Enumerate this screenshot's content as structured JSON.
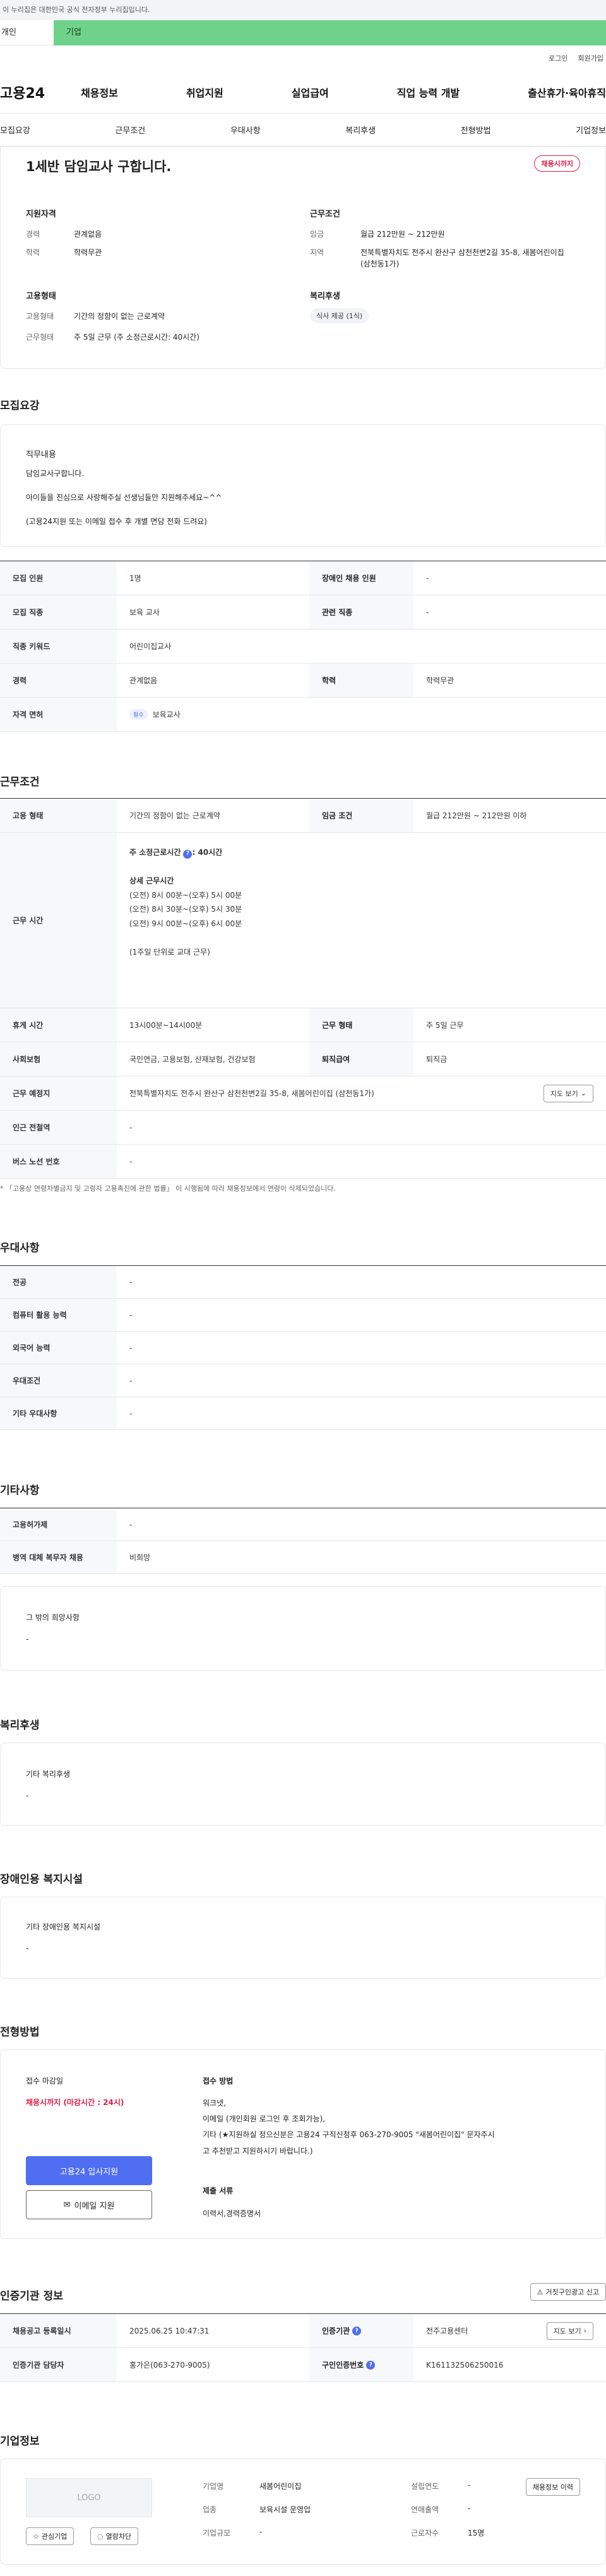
{
  "gov_banner": "이 누리집은 대한민국 공식 전자정부 누리집입니다.",
  "segment": {
    "a": "개인",
    "b": "기업"
  },
  "util": {
    "login": "로그인",
    "join": "회원가입"
  },
  "gnb": {
    "logo": "고용24",
    "items": [
      "채용정보",
      "취업지원",
      "실업급여",
      "직업 능력 개발",
      "출산휴가·육아휴직"
    ]
  },
  "tabs": [
    "모집요강",
    "근무조건",
    "우대사항",
    "복리후생",
    "전형방법",
    "기업정보"
  ],
  "summary": {
    "title": "1세반 담임교사 구합니다.",
    "status": "채용시까지",
    "qual": {
      "title": "지원자격",
      "rows": [
        {
          "k": "경력",
          "v": "관계없음"
        },
        {
          "k": "학력",
          "v": "학력무관"
        }
      ]
    },
    "cond": {
      "title": "근무조건",
      "rows": [
        {
          "k": "임금",
          "v": "월급 212만원 ~ 212만원"
        },
        {
          "k": "지역",
          "v": "전북특별자치도 전주시 완산구 삼천천변2길 35-8, 새봄어린이집 (삼천동1가)"
        }
      ]
    },
    "emp": {
      "title": "고용형태",
      "rows": [
        {
          "k": "고용형태",
          "v": "기간의 정함이 없는 근로계약"
        },
        {
          "k": "근무형태",
          "v": "주 5일 근무 (주 소정근로시간: 40시간)"
        }
      ]
    },
    "welfare": {
      "title": "복리후생",
      "tag": "식사 제공 (1식)"
    }
  },
  "recruit": {
    "heading": "모집요강",
    "duty_title": "직무내용",
    "duty_lines": [
      "담임교사구합니다.",
      "아이들을 진심으로 사랑해주실 선생님들만 지원해주세요~^^",
      "(고용24지원 또는 이메일 접수 후 개별 면담 전화 드려요)"
    ],
    "rows": [
      {
        "k1": "모집 인원",
        "v1": "1명",
        "k2": "장애인 채용 인원",
        "v2": "-"
      },
      {
        "k1": "모집 직종",
        "v1": "보육 교사",
        "k2": "관련 직종",
        "v2": "-"
      },
      {
        "k1": "직종 키워드",
        "v1": "어린이집교사"
      },
      {
        "k1": "경력",
        "v1": "관계없음",
        "k2": "학력",
        "v2": "학력무관"
      },
      {
        "k1": "자격 면허",
        "mini": "필수",
        "v1": "보육교사"
      }
    ]
  },
  "work": {
    "heading": "근무조건",
    "r1": {
      "k1": "고용 형태",
      "v1": "기간의 정함이 없는 근로계약",
      "k2": "임금 조건",
      "v2": "월급 212만원 ~ 212만원 이하"
    },
    "hours_label": "근무 시간",
    "hours": {
      "total": "주 소정근로시간",
      "total_q": "?",
      "total_v": ": 40시간",
      "detail": "상세 근무시간",
      "lines": [
        "(오전) 8시 00분~(오후) 5시 00분",
        "(오전) 8시 30분~(오후) 5시 30분",
        "(오전) 9시 00분~(오후) 6시 00분"
      ],
      "note": "(1주일 단위로 교대 근무)"
    },
    "rows": [
      {
        "k1": "휴게 시간",
        "v1": "13시00분~14시00분",
        "k2": "근무 형태",
        "v2": "주 5일 근무"
      },
      {
        "k1": "사회보험",
        "v1": "국민연금, 고용보험, 산재보험, 건강보험",
        "k2": "퇴직급여",
        "v2": "퇴직금"
      }
    ],
    "place": {
      "k": "근무 예정지",
      "v": "전북특별자치도 전주시 완산구 삼천천변2길 35-8, 새봄어린이집 (삼천동1가)",
      "btn": "지도 보기"
    },
    "rows2": [
      {
        "k": "인근 전철역",
        "v": "-"
      },
      {
        "k": "버스 노선 번호",
        "v": "-"
      }
    ],
    "note": "* 「고용상 연령차별금지 및 고령자 고용촉진에 관한 법률」 이 시행됨에 따라 채용정보에서 연령이 삭제되었습니다."
  },
  "pref": {
    "heading": "우대사항",
    "rows": [
      {
        "k": "전공",
        "v": "-"
      },
      {
        "k": "컴퓨터 활용 능력",
        "v": "-"
      },
      {
        "k": "외국어 능력",
        "v": "-"
      },
      {
        "k": "우대조건",
        "v": "-"
      },
      {
        "k": "기타 우대사항",
        "v": "-"
      }
    ]
  },
  "etc": {
    "heading": "기타사항",
    "rows": [
      {
        "k": "고용허가제",
        "v": "-"
      },
      {
        "k": "병역 대체 복무자 채용",
        "v": "비희망"
      }
    ],
    "wish_title": "그 밖의 희망사항",
    "wish_v": "-"
  },
  "welfare2": {
    "heading": "복리후생",
    "title": "기타 복리후생",
    "v": "-"
  },
  "disabled": {
    "heading": "장애인용 복지시설",
    "title": "기타 장애인용 복지시설",
    "v": "-"
  },
  "process": {
    "heading": "전형방법",
    "deadline_title": "접수 마감일",
    "deadline": "채용시까지 (마감시간 : 24시)",
    "apply_btn": "고용24 입사지원",
    "email_btn": "이메일 지원",
    "method_title": "접수 방법",
    "method_lines": [
      "워크넷,",
      "이메일 (개인회원 로그인 후 조회가능),",
      "기타 (★지원하실 정으신분은 고용24 구직신청후 063-270-9005 \"새봄어린이집\" 문자주시",
      "고  추천받고 지원하시기 바랍니다.)"
    ],
    "docs_title": "제출 서류",
    "docs": "이력서,경력증명서"
  },
  "agency": {
    "heading": "인증기관 정보",
    "report_btn": "거짓구인광고 신고",
    "rows": [
      {
        "k1": "채용공고 등록일시",
        "v1": "2025.06.25 10:47:31",
        "k2": "인증기관",
        "v2": "전주고용센터",
        "btn": "지도 보기"
      },
      {
        "k1": "인증기관 담당자",
        "v1": "홍가은(063-270-9005)",
        "k2": "구인인증번호",
        "v2": "K161132506250016"
      }
    ]
  },
  "company": {
    "heading": "기업정보",
    "logo": "LOGO",
    "fav_btn": "관심기업",
    "block_btn": "열람차단",
    "info_btn": "채용정보 이력",
    "fields": [
      {
        "k": "기업명",
        "v": "새봄어린이집",
        "k2": "설립연도",
        "v2": "-"
      },
      {
        "k": "업종",
        "v": "보육시설 운영업",
        "k2": "연매출액",
        "v2": "-"
      },
      {
        "k": "기업규모",
        "v": "-",
        "k2": "근로자수",
        "v2": "15명"
      }
    ]
  }
}
